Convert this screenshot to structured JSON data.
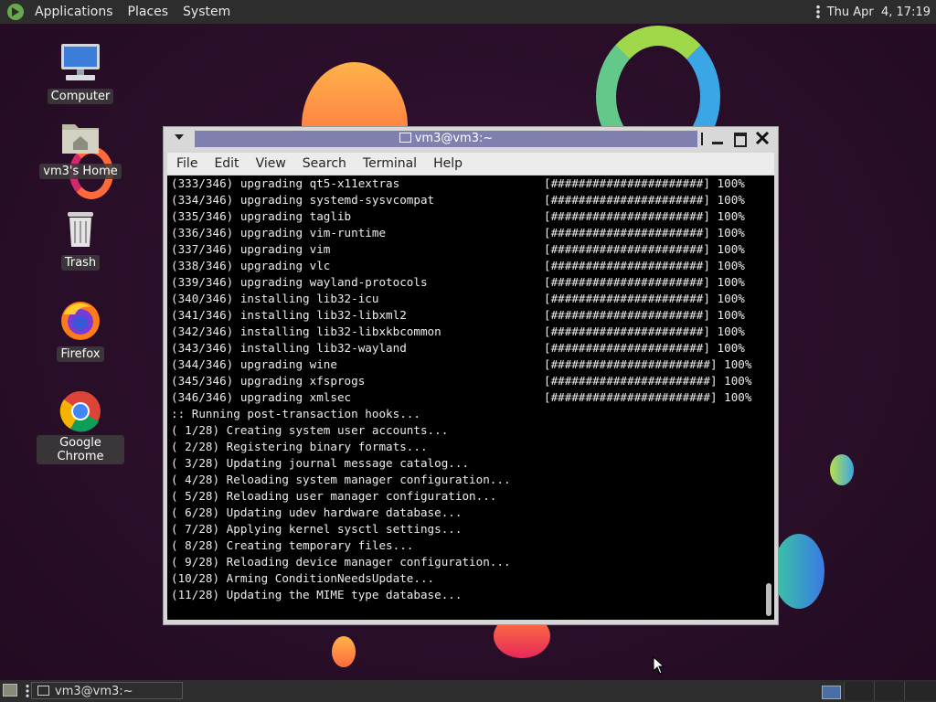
{
  "top_panel": {
    "menus": [
      "Applications",
      "Places",
      "System"
    ],
    "clock": "Thu Apr  4, 17:19"
  },
  "desktop_icons": [
    {
      "label": "Computer",
      "icon": "computer-icon"
    },
    {
      "label": "vm3's Home",
      "icon": "home-folder-icon"
    },
    {
      "label": "Trash",
      "icon": "trash-icon"
    },
    {
      "label": "Firefox",
      "icon": "firefox-icon"
    },
    {
      "label": "Google Chrome",
      "icon": "chrome-icon"
    }
  ],
  "terminal": {
    "title": "vm3@vm3:~",
    "menu": [
      "File",
      "Edit",
      "View",
      "Search",
      "Terminal",
      "Help"
    ],
    "progress_lines": [
      {
        "text": "(333/346) upgrading qt5-x11extras",
        "bar": "[######################] 100%"
      },
      {
        "text": "(334/346) upgrading systemd-sysvcompat",
        "bar": "[######################] 100%"
      },
      {
        "text": "(335/346) upgrading taglib",
        "bar": "[######################] 100%"
      },
      {
        "text": "(336/346) upgrading vim-runtime",
        "bar": "[######################] 100%"
      },
      {
        "text": "(337/346) upgrading vim",
        "bar": "[######################] 100%"
      },
      {
        "text": "(338/346) upgrading vlc",
        "bar": "[######################] 100%"
      },
      {
        "text": "(339/346) upgrading wayland-protocols",
        "bar": "[######################] 100%"
      },
      {
        "text": "(340/346) installing lib32-icu",
        "bar": "[######################] 100%"
      },
      {
        "text": "(341/346) installing lib32-libxml2",
        "bar": "[######################] 100%"
      },
      {
        "text": "(342/346) installing lib32-libxkbcommon",
        "bar": "[######################] 100%"
      },
      {
        "text": "(343/346) installing lib32-wayland",
        "bar": "[######################] 100%"
      },
      {
        "text": "(344/346) upgrading wine",
        "bar": "[#######################] 100%"
      },
      {
        "text": "(345/346) upgrading xfsprogs",
        "bar": "[#######################] 100%"
      },
      {
        "text": "(346/346) upgrading xmlsec",
        "bar": "[#######################] 100%"
      }
    ],
    "hook_lines": [
      ":: Running post-transaction hooks...",
      "( 1/28) Creating system user accounts...",
      "( 2/28) Registering binary formats...",
      "( 3/28) Updating journal message catalog...",
      "( 4/28) Reloading system manager configuration...",
      "( 5/28) Reloading user manager configuration...",
      "( 6/28) Updating udev hardware database...",
      "( 7/28) Applying kernel sysctl settings...",
      "( 8/28) Creating temporary files...",
      "( 9/28) Reloading device manager configuration...",
      "(10/28) Arming ConditionNeedsUpdate...",
      "(11/28) Updating the MIME type database..."
    ]
  },
  "taskbar": {
    "task_label": "vm3@vm3:~"
  }
}
